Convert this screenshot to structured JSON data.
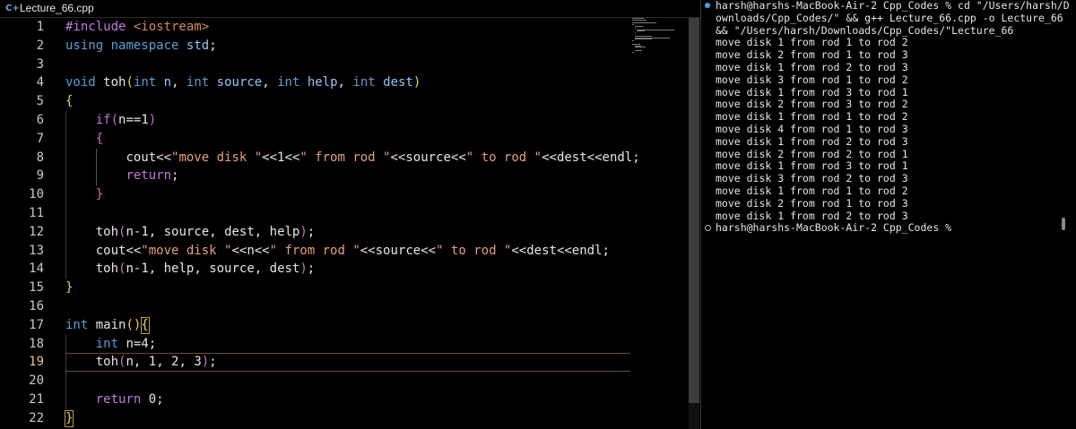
{
  "editor": {
    "tab": {
      "icon": "cpp-file-icon",
      "label": "Lecture_66.cpp"
    },
    "active_line": 19,
    "line_numbers": [
      "1",
      "2",
      "3",
      "4",
      "5",
      "6",
      "7",
      "8",
      "9",
      "10",
      "11",
      "12",
      "13",
      "14",
      "15",
      "16",
      "17",
      "18",
      "19",
      "20",
      "21",
      "22"
    ],
    "lines": [
      [
        [
          "c-pp",
          "#include "
        ],
        [
          "c-inc",
          "<iostream>"
        ]
      ],
      [
        [
          "c-kw",
          "using"
        ],
        [
          "c-op",
          " "
        ],
        [
          "c-kw",
          "namespace"
        ],
        [
          "c-op",
          " "
        ],
        [
          "c-id",
          "std"
        ],
        [
          "c-op",
          ";"
        ]
      ],
      [],
      [
        [
          "c-kw",
          "void"
        ],
        [
          "c-op",
          " "
        ],
        [
          "c-fn",
          "toh"
        ],
        [
          "c-br1",
          "("
        ],
        [
          "c-kw",
          "int"
        ],
        [
          "c-op",
          " "
        ],
        [
          "c-id",
          "n"
        ],
        [
          "c-op",
          ", "
        ],
        [
          "c-kw",
          "int"
        ],
        [
          "c-op",
          " "
        ],
        [
          "c-id",
          "source"
        ],
        [
          "c-op",
          ", "
        ],
        [
          "c-kw",
          "int"
        ],
        [
          "c-op",
          " "
        ],
        [
          "c-id",
          "help"
        ],
        [
          "c-op",
          ", "
        ],
        [
          "c-kw",
          "int"
        ],
        [
          "c-op",
          " "
        ],
        [
          "c-id",
          "dest"
        ],
        [
          "c-br1",
          ")"
        ]
      ],
      [
        [
          "c-br1",
          "{"
        ]
      ],
      [
        [
          "c-op",
          "    "
        ],
        [
          "c-ctl",
          "if"
        ],
        [
          "c-br2",
          "("
        ],
        [
          "c-fn",
          "n"
        ],
        [
          "c-op",
          "=="
        ],
        [
          "c-num",
          "1"
        ],
        [
          "c-br2",
          ")"
        ]
      ],
      [
        [
          "c-op",
          "    "
        ],
        [
          "c-br2",
          "{"
        ]
      ],
      [
        [
          "c-op",
          "        "
        ],
        [
          "c-fn",
          "cout"
        ],
        [
          "c-op",
          "<<"
        ],
        [
          "c-str",
          "\"move disk \""
        ],
        [
          "c-op",
          "<<"
        ],
        [
          "c-num",
          "1"
        ],
        [
          "c-op",
          "<<"
        ],
        [
          "c-str",
          "\" from rod \""
        ],
        [
          "c-op",
          "<<"
        ],
        [
          "c-fn",
          "source"
        ],
        [
          "c-op",
          "<<"
        ],
        [
          "c-str",
          "\" to rod \""
        ],
        [
          "c-op",
          "<<"
        ],
        [
          "c-fn",
          "dest"
        ],
        [
          "c-op",
          "<<"
        ],
        [
          "c-fn",
          "endl"
        ],
        [
          "c-op",
          ";"
        ]
      ],
      [
        [
          "c-op",
          "        "
        ],
        [
          "c-ctl",
          "return"
        ],
        [
          "c-op",
          ";"
        ]
      ],
      [
        [
          "c-op",
          "    "
        ],
        [
          "c-br2",
          "}"
        ]
      ],
      [],
      [
        [
          "c-op",
          "    "
        ],
        [
          "c-fn",
          "toh"
        ],
        [
          "c-br2",
          "("
        ],
        [
          "c-fn",
          "n"
        ],
        [
          "c-op",
          "-"
        ],
        [
          "c-num",
          "1"
        ],
        [
          "c-op",
          ", "
        ],
        [
          "c-fn",
          "source"
        ],
        [
          "c-op",
          ", "
        ],
        [
          "c-fn",
          "dest"
        ],
        [
          "c-op",
          ", "
        ],
        [
          "c-fn",
          "help"
        ],
        [
          "c-br2",
          ")"
        ],
        [
          "c-op",
          ";"
        ]
      ],
      [
        [
          "c-op",
          "    "
        ],
        [
          "c-fn",
          "cout"
        ],
        [
          "c-op",
          "<<"
        ],
        [
          "c-str",
          "\"move disk \""
        ],
        [
          "c-op",
          "<<"
        ],
        [
          "c-fn",
          "n"
        ],
        [
          "c-op",
          "<<"
        ],
        [
          "c-str",
          "\" from rod \""
        ],
        [
          "c-op",
          "<<"
        ],
        [
          "c-fn",
          "source"
        ],
        [
          "c-op",
          "<<"
        ],
        [
          "c-str",
          "\" to rod \""
        ],
        [
          "c-op",
          "<<"
        ],
        [
          "c-fn",
          "dest"
        ],
        [
          "c-op",
          "<<"
        ],
        [
          "c-fn",
          "endl"
        ],
        [
          "c-op",
          ";"
        ]
      ],
      [
        [
          "c-op",
          "    "
        ],
        [
          "c-fn",
          "toh"
        ],
        [
          "c-br2",
          "("
        ],
        [
          "c-fn",
          "n"
        ],
        [
          "c-op",
          "-"
        ],
        [
          "c-num",
          "1"
        ],
        [
          "c-op",
          ", "
        ],
        [
          "c-fn",
          "help"
        ],
        [
          "c-op",
          ", "
        ],
        [
          "c-fn",
          "source"
        ],
        [
          "c-op",
          ", "
        ],
        [
          "c-fn",
          "dest"
        ],
        [
          "c-br2",
          ")"
        ],
        [
          "c-op",
          ";"
        ]
      ],
      [
        [
          "c-br1",
          "}"
        ]
      ],
      [],
      [
        [
          "c-kw",
          "int"
        ],
        [
          "c-op",
          " "
        ],
        [
          "c-fn",
          "main"
        ],
        [
          "c-br1",
          "()"
        ],
        [
          "c-br1",
          "{"
        ]
      ],
      [
        [
          "c-op",
          "    "
        ],
        [
          "c-kw",
          "int"
        ],
        [
          "c-op",
          " "
        ],
        [
          "c-fn",
          "n"
        ],
        [
          "c-op",
          "="
        ],
        [
          "c-num",
          "4"
        ],
        [
          "c-op",
          ";"
        ]
      ],
      [
        [
          "c-op",
          "    "
        ],
        [
          "c-fn",
          "toh"
        ],
        [
          "c-br2",
          "("
        ],
        [
          "c-fn",
          "n"
        ],
        [
          "c-op",
          ", "
        ],
        [
          "c-num",
          "1"
        ],
        [
          "c-op",
          ", "
        ],
        [
          "c-num",
          "2"
        ],
        [
          "c-op",
          ", "
        ],
        [
          "c-num",
          "3"
        ],
        [
          "c-br2",
          ")"
        ],
        [
          "c-op",
          ";"
        ]
      ],
      [],
      [
        [
          "c-op",
          "    "
        ],
        [
          "c-ctl",
          "return"
        ],
        [
          "c-op",
          " "
        ],
        [
          "c-num",
          "0"
        ],
        [
          "c-op",
          ";"
        ]
      ],
      [
        [
          "c-br1",
          "}"
        ]
      ]
    ]
  },
  "terminal": {
    "lines": [
      "harsh@harshs-MacBook-Air-2 Cpp_Codes % cd \"/Users/harsh/D",
      "ownloads/Cpp_Codes/\" && g++ Lecture_66.cpp -o Lecture_66",
      "&& \"/Users/harsh/Downloads/Cpp_Codes/\"Lecture_66",
      "move disk 1 from rod 1 to rod 2",
      "move disk 2 from rod 1 to rod 3",
      "move disk 1 from rod 2 to rod 3",
      "move disk 3 from rod 1 to rod 2",
      "move disk 1 from rod 3 to rod 1",
      "move disk 2 from rod 3 to rod 2",
      "move disk 1 from rod 1 to rod 2",
      "move disk 4 from rod 1 to rod 3",
      "move disk 1 from rod 2 to rod 3",
      "move disk 2 from rod 2 to rod 1",
      "move disk 1 from rod 3 to rod 1",
      "move disk 3 from rod 2 to rod 3",
      "move disk 1 from rod 1 to rod 2",
      "move disk 2 from rod 1 to rod 3",
      "move disk 1 from rod 2 to rod 3"
    ],
    "prompt": "harsh@harshs-MacBook-Air-2 Cpp_Codes %",
    "colors": {
      "success_dot": "#4a9df8",
      "idle_dot": "#bbbbbb"
    }
  }
}
